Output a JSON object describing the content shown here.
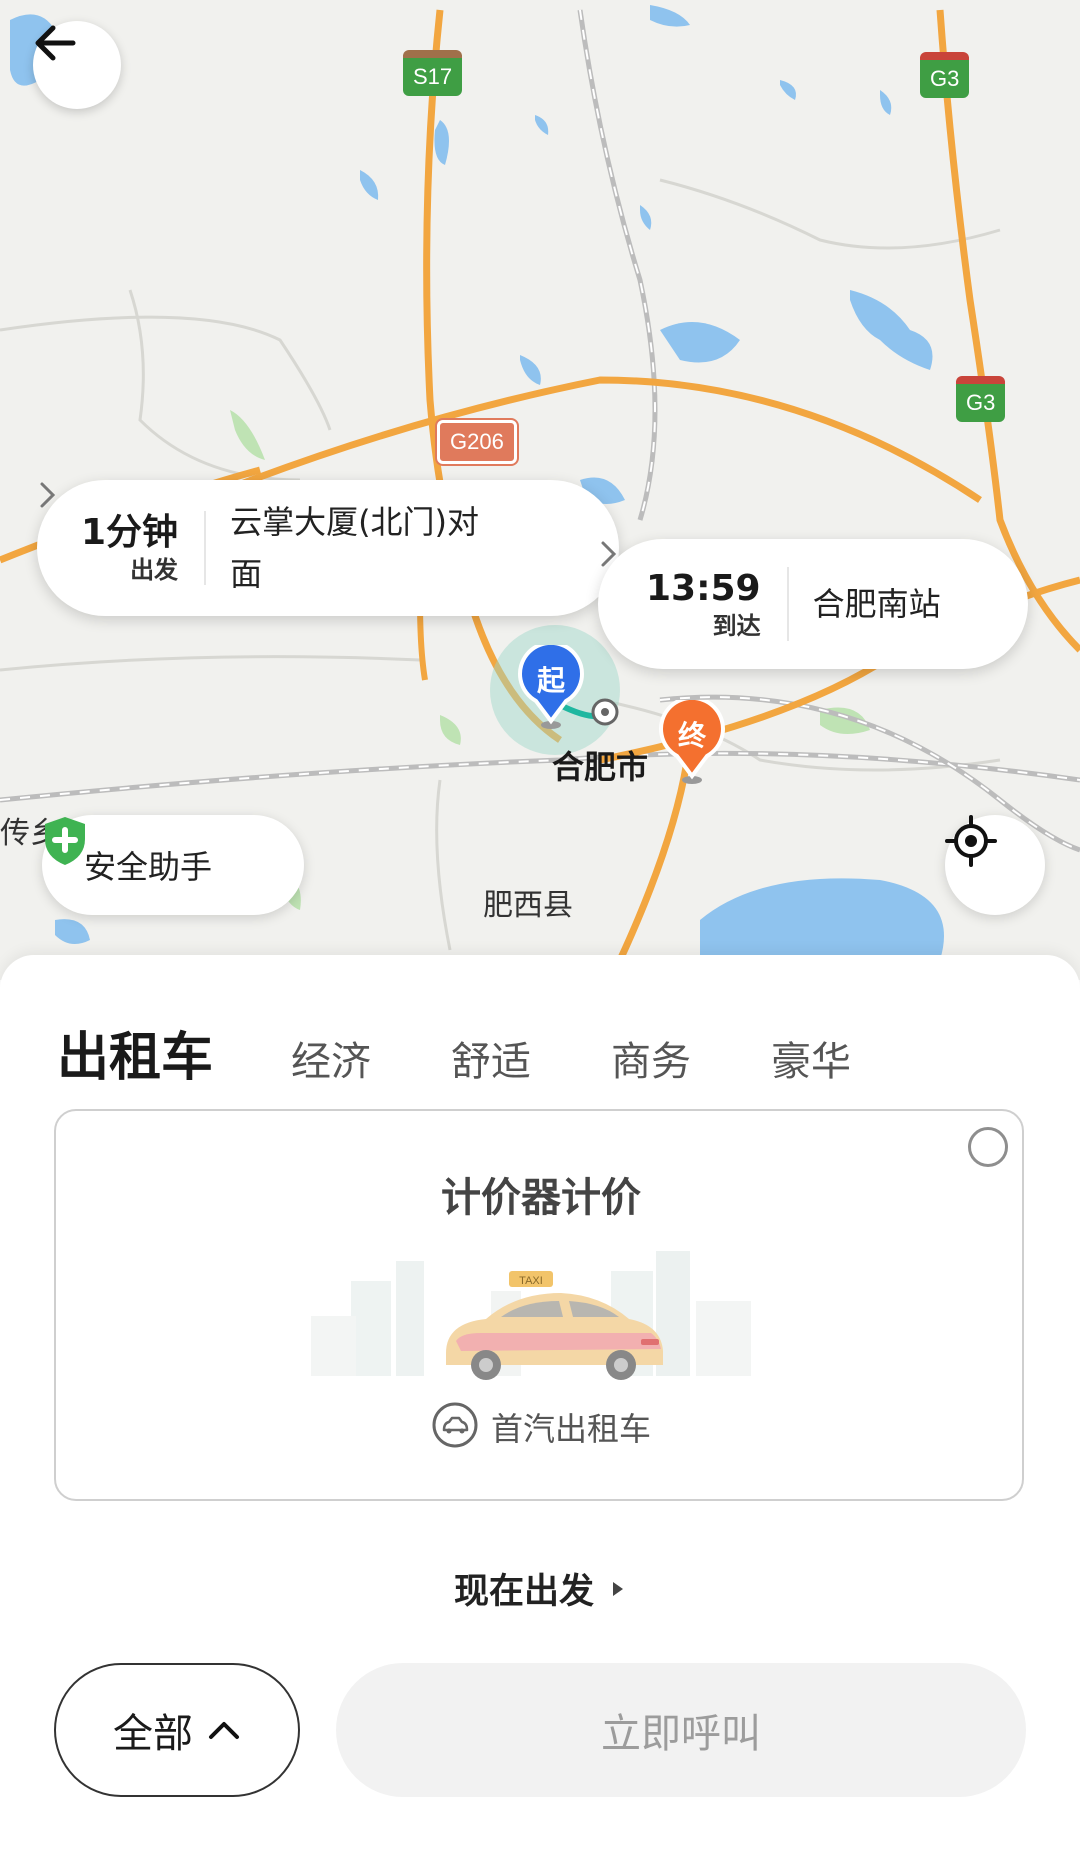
{
  "map": {
    "road_shields": [
      "S17",
      "G3",
      "G206",
      "G3"
    ],
    "labels": {
      "city": "合肥市",
      "county": "肥西县",
      "edge_text": "传乡"
    },
    "back_icon": "arrow-left-icon",
    "pickup": {
      "time": "1分钟",
      "time_sub": "出发",
      "place": "云掌大厦(北门)对面",
      "pin_label": "起",
      "pin_color": "#2f6fe8"
    },
    "destination": {
      "time": "13:59",
      "time_sub": "到达",
      "place": "合肥南站",
      "pin_label": "终",
      "pin_color": "#f4702f"
    },
    "safety": {
      "label": "安全助手",
      "icon": "shield-plus-icon",
      "color": "#3fb352"
    },
    "locate_icon": "locate-icon"
  },
  "sheet": {
    "tabs": [
      {
        "label": "出租车",
        "active": true
      },
      {
        "label": "经济",
        "active": false
      },
      {
        "label": "舒适",
        "active": false
      },
      {
        "label": "商务",
        "active": false
      },
      {
        "label": "豪华",
        "active": false
      }
    ],
    "fare_card": {
      "title": "计价器计价",
      "taxi_sign": "TAXI",
      "provider": "首汽出租车",
      "selected": false
    },
    "depart_now": "现在出发",
    "all_button": "全部",
    "call_button": "立即呼叫"
  }
}
